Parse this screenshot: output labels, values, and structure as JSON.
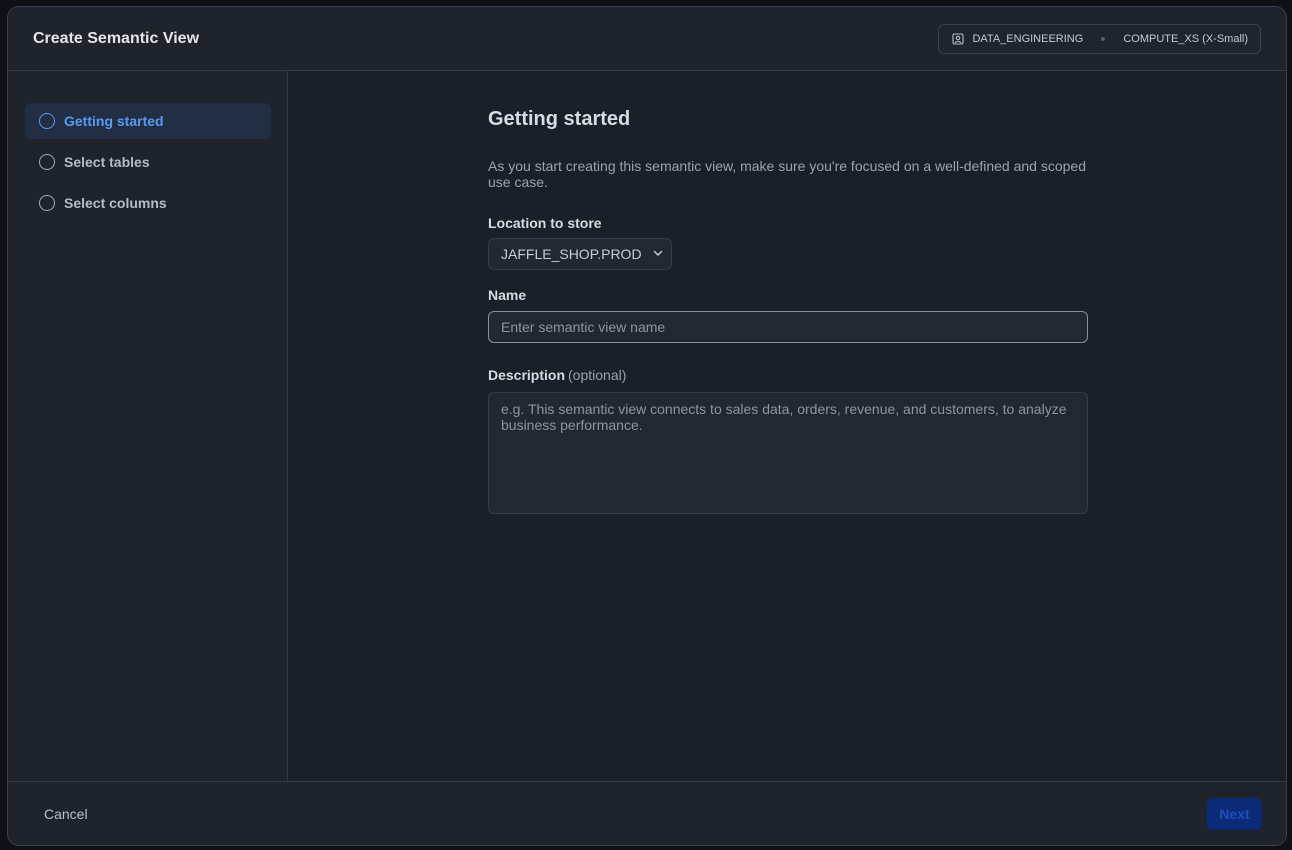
{
  "modal": {
    "title": "Create Semantic View",
    "context": {
      "role": "DATA_ENGINEERING",
      "warehouse": "COMPUTE_XS (X-Small)"
    }
  },
  "sidebar": {
    "steps": [
      {
        "label": "Getting started",
        "active": true
      },
      {
        "label": "Select tables",
        "active": false
      },
      {
        "label": "Select columns",
        "active": false
      }
    ]
  },
  "main": {
    "heading": "Getting started",
    "intro": "As you start creating this semantic view, make sure you're focused on a well-defined and scoped use case.",
    "location": {
      "label": "Location to store",
      "value": "JAFFLE_SHOP.PROD"
    },
    "name": {
      "label": "Name",
      "placeholder": "Enter semantic view name",
      "value": ""
    },
    "description": {
      "label": "Description",
      "optional": "(optional)",
      "placeholder": "e.g. This semantic view connects to sales data, orders, revenue, and customers, to analyze business performance.",
      "value": ""
    }
  },
  "footer": {
    "cancel_label": "Cancel",
    "next_label": "Next"
  },
  "colors": {
    "accent": "#5a9bf0",
    "primary_button": "#0b2a78"
  }
}
